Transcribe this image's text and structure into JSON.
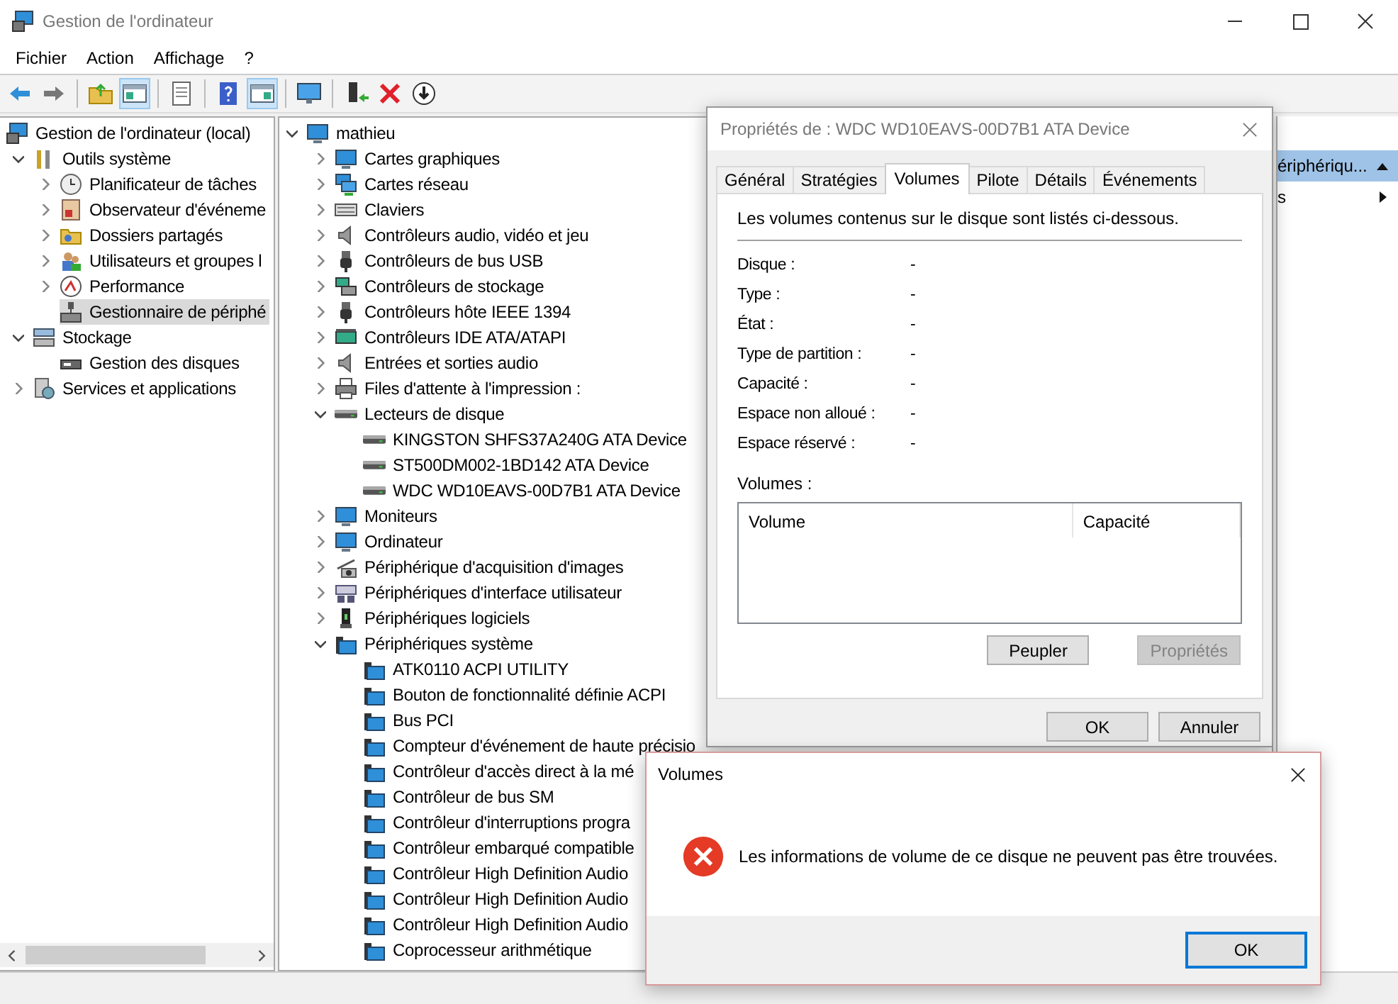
{
  "window": {
    "title": "Gestion de l'ordinateur"
  },
  "menu": [
    "Fichier",
    "Action",
    "Affichage",
    "?"
  ],
  "toolbar": [
    {
      "pressed": false
    },
    {
      "pressed": false
    },
    {
      "pressed": false
    },
    {
      "pressed": true
    },
    {
      "pressed": false
    },
    {
      "pressed": false
    },
    {
      "pressed": true
    },
    {
      "pressed": false
    },
    {
      "pressed": false
    },
    {
      "pressed": false
    },
    {
      "pressed": false
    }
  ],
  "console_tree": [
    {
      "label": "Gestion de l'ordinateur (local)",
      "selected": false,
      "children": [
        {
          "label": "Outils système",
          "expanded": true,
          "selected": false,
          "children": [
            {
              "label": "Planificateur de tâches",
              "expanded": false,
              "selected": false
            },
            {
              "label": "Observateur d'événeme",
              "expanded": false,
              "selected": false
            },
            {
              "label": "Dossiers partagés",
              "expanded": false,
              "selected": false
            },
            {
              "label": "Utilisateurs et groupes l",
              "expanded": false,
              "selected": false
            },
            {
              "label": "Performance",
              "expanded": false,
              "selected": false
            },
            {
              "label": "Gestionnaire de périphé",
              "selected": true
            }
          ]
        },
        {
          "label": "Stockage",
          "expanded": true,
          "selected": false,
          "children": [
            {
              "label": "Gestion des disques",
              "selected": false
            }
          ]
        },
        {
          "label": "Services et applications",
          "expanded": false,
          "selected": false
        }
      ]
    }
  ],
  "device_tree": [
    {
      "label": "mathieu",
      "expanded": true,
      "children": [
        {
          "label": "Cartes graphiques",
          "expanded": false
        },
        {
          "label": "Cartes réseau",
          "expanded": false
        },
        {
          "label": "Claviers",
          "expanded": false
        },
        {
          "label": "Contrôleurs audio, vidéo et jeu",
          "expanded": false
        },
        {
          "label": "Contrôleurs de bus USB",
          "expanded": false
        },
        {
          "label": "Contrôleurs de stockage",
          "expanded": false
        },
        {
          "label": "Contrôleurs hôte IEEE 1394",
          "expanded": false
        },
        {
          "label": "Contrôleurs IDE ATA/ATAPI",
          "expanded": false
        },
        {
          "label": "Entrées et sorties audio",
          "expanded": false
        },
        {
          "label": "Files d'attente à l'impression :",
          "expanded": false
        },
        {
          "label": "Lecteurs de disque",
          "expanded": true,
          "children": [
            {
              "label": "KINGSTON SHFS37A240G ATA Device"
            },
            {
              "label": "ST500DM002-1BD142 ATA Device"
            },
            {
              "label": "WDC WD10EAVS-00D7B1 ATA Device"
            }
          ]
        },
        {
          "label": "Moniteurs",
          "expanded": false
        },
        {
          "label": "Ordinateur",
          "expanded": false
        },
        {
          "label": "Périphérique d'acquisition d'images",
          "expanded": false
        },
        {
          "label": "Périphériques d'interface utilisateur",
          "expanded": false
        },
        {
          "label": "Périphériques logiciels",
          "expanded": false
        },
        {
          "label": "Périphériques système",
          "expanded": true,
          "children": [
            {
              "label": "ATK0110 ACPI UTILITY"
            },
            {
              "label": "Bouton de fonctionnalité définie ACPI"
            },
            {
              "label": "Bus PCI"
            },
            {
              "label": "Compteur d'événement de haute précisio"
            },
            {
              "label": "Contrôleur d'accès direct à la mé"
            },
            {
              "label": "Contrôleur de bus SM"
            },
            {
              "label": "Contrôleur d'interruptions progra"
            },
            {
              "label": "Contrôleur embarqué compatible"
            },
            {
              "label": "Contrôleur High Definition Audio"
            },
            {
              "label": "Contrôleur High Definition Audio"
            },
            {
              "label": "Contrôleur High Definition Audio"
            },
            {
              "label": "Coprocesseur arithmétique"
            }
          ]
        }
      ]
    }
  ],
  "actions_pane": {
    "header": "ériphériqu...",
    "item": "s"
  },
  "properties_dialog": {
    "title": "Propriétés de : WDC WD10EAVS-00D7B1 ATA Device",
    "tabs": [
      {
        "label": "Général",
        "selected": false
      },
      {
        "label": "Stratégies",
        "selected": false
      },
      {
        "label": "Volumes",
        "selected": true
      },
      {
        "label": "Pilote",
        "selected": false
      },
      {
        "label": "Détails",
        "selected": false
      },
      {
        "label": "Événements",
        "selected": false
      }
    ],
    "description": "Les volumes contenus sur le disque sont listés ci-dessous.",
    "fields": [
      {
        "label": "Disque :",
        "value": "-"
      },
      {
        "label": "Type :",
        "value": "-"
      },
      {
        "label": "État :",
        "value": "-"
      },
      {
        "label": "Type de partition :",
        "value": "-"
      },
      {
        "label": "Capacité :",
        "value": "-"
      },
      {
        "label": "Espace non alloué :",
        "value": "-"
      },
      {
        "label": "Espace réservé :",
        "value": "-"
      }
    ],
    "volumes_label": "Volumes :",
    "columns": [
      "Volume",
      "Capacité"
    ],
    "buttons": [
      {
        "label": "Peupler",
        "disabled": false
      },
      {
        "label": "Propriétés",
        "disabled": true
      }
    ],
    "footer_buttons": [
      "OK",
      "Annuler"
    ]
  },
  "error_dialog": {
    "title": "Volumes",
    "message": "Les informations de volume de ce disque ne peuvent pas être trouvées.",
    "button": "OK"
  }
}
